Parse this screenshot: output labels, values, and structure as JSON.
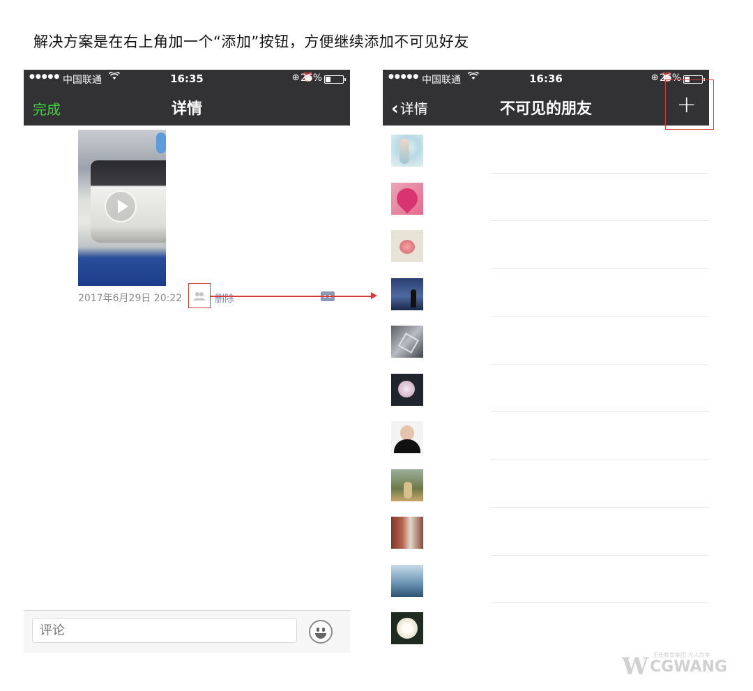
{
  "caption": "解决方案是在右上角加一个“添加”按钮，方便继续添加不可见好友",
  "left_phone": {
    "status": {
      "dots": "●●●●●",
      "carrier": "中国联通",
      "wifi_icon": "wifi-icon",
      "time": "16:35",
      "battery_pct": "26%"
    },
    "nav": {
      "done_label": "完成",
      "title": "详情"
    },
    "post": {
      "timestamp": "2017年6月29日 20:22",
      "delete_label": "删除"
    },
    "comment": {
      "placeholder": "评论"
    }
  },
  "right_phone": {
    "status": {
      "dots": "●●●●●",
      "carrier": "中国联通",
      "wifi_icon": "wifi-icon",
      "time": "16:36",
      "battery_pct": "26%"
    },
    "nav": {
      "back_label": "详情",
      "title": "不可见的朋友",
      "add_label": "+"
    },
    "friends_count": 11
  },
  "colors": {
    "nav_bg": "#323235",
    "done_green": "#3fd23a",
    "annotation_red": "#d83a3a",
    "link_blue": "#7b8aa8"
  },
  "watermark": {
    "brand": "CGWANG",
    "slogan": "王氏教育集团 人人为本"
  }
}
